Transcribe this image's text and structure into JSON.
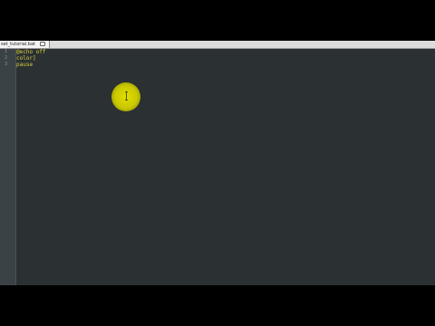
{
  "tab": {
    "filename": "set_tutorial.bat"
  },
  "editor": {
    "line_numbers": [
      "1",
      "2",
      "3"
    ],
    "lines": [
      "@echo off",
      "color]",
      "pause"
    ]
  },
  "colors": {
    "code_text": "#d9cf3a",
    "editor_background": "#2b3033",
    "cursor_highlight": "#d4d200"
  },
  "icons": {
    "tab_close": "close-icon",
    "cursor": "text-cursor-icon"
  }
}
